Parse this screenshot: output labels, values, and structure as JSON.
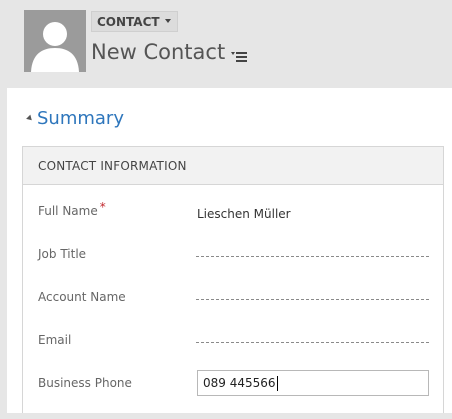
{
  "header": {
    "entity_label": "CONTACT",
    "record_title": "New Contact",
    "avatar_icon": "person-avatar-icon",
    "menu_icon": "nav-menu-icon"
  },
  "tab": {
    "label": "Summary",
    "expanded": true
  },
  "section": {
    "title": "CONTACT INFORMATION",
    "fields": [
      {
        "label": "Full Name",
        "required": "*",
        "value": "Lieschen Müller"
      },
      {
        "label": "Job Title",
        "value": ""
      },
      {
        "label": "Account Name",
        "value": ""
      },
      {
        "label": "Email",
        "value": ""
      },
      {
        "label": "Business Phone",
        "value": "089 445566"
      }
    ]
  },
  "colors": {
    "accent": "#2e76bc",
    "required": "#c1272d",
    "header_bg": "#e6e6e6"
  }
}
